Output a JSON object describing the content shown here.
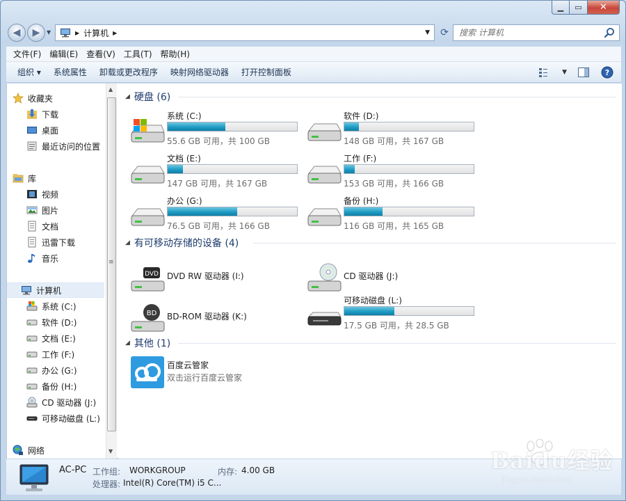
{
  "address": {
    "location": "计算机"
  },
  "search": {
    "placeholder": "搜索 计算机"
  },
  "menu": [
    {
      "label": "文件(F)"
    },
    {
      "label": "编辑(E)"
    },
    {
      "label": "查看(V)"
    },
    {
      "label": "工具(T)"
    },
    {
      "label": "帮助(H)"
    }
  ],
  "commands": [
    {
      "label": "组织 ▾"
    },
    {
      "label": "系统属性"
    },
    {
      "label": "卸载或更改程序"
    },
    {
      "label": "映射网络驱动器"
    },
    {
      "label": "打开控制面板"
    }
  ],
  "nav": {
    "favorites": {
      "label": "收藏夹",
      "items": [
        {
          "label": "下载"
        },
        {
          "label": "桌面"
        },
        {
          "label": "最近访问的位置"
        }
      ]
    },
    "libraries": {
      "label": "库",
      "items": [
        {
          "label": "视频"
        },
        {
          "label": "图片"
        },
        {
          "label": "文档"
        },
        {
          "label": "迅雷下载"
        },
        {
          "label": "音乐"
        }
      ]
    },
    "computer": {
      "label": "计算机",
      "items": [
        {
          "label": "系统 (C:)"
        },
        {
          "label": "软件 (D:)"
        },
        {
          "label": "文档 (E:)"
        },
        {
          "label": "工作 (F:)"
        },
        {
          "label": "办公 (G:)"
        },
        {
          "label": "备份 (H:)"
        },
        {
          "label": "CD 驱动器 (J:)"
        },
        {
          "label": "可移动磁盘 (L:)"
        }
      ]
    },
    "network": {
      "label": "网络"
    }
  },
  "groups": {
    "hard_disks": {
      "title": "硬盘 (6)"
    },
    "removable": {
      "title": "有可移动存储的设备 (4)"
    },
    "other": {
      "title": "其他 (1)"
    }
  },
  "drives": [
    {
      "name": "系统 (C:)",
      "free": "55.6 GB 可用，共 100 GB",
      "used_fraction": 0.444
    },
    {
      "name": "软件 (D:)",
      "free": "148 GB 可用，共 167 GB",
      "used_fraction": 0.114
    },
    {
      "name": "文档 (E:)",
      "free": "147 GB 可用，共 167 GB",
      "used_fraction": 0.12
    },
    {
      "name": "工作 (F:)",
      "free": "153 GB 可用，共 166 GB",
      "used_fraction": 0.078
    },
    {
      "name": "办公 (G:)",
      "free": "76.5 GB 可用，共 166 GB",
      "used_fraction": 0.539
    },
    {
      "name": "备份 (H:)",
      "free": "116 GB 可用，共 165 GB",
      "used_fraction": 0.297
    }
  ],
  "devices": [
    {
      "name": "DVD RW 驱动器 (I:)",
      "badge": "DVD"
    },
    {
      "name": "CD 驱动器 (J:)"
    },
    {
      "name": "BD-ROM 驱动器 (K:)",
      "badge": "BD"
    },
    {
      "name": "可移动磁盘 (L:)",
      "free": "17.5 GB 可用，共 28.5 GB",
      "used_fraction": 0.386
    }
  ],
  "other_items": [
    {
      "name": "百度云管家",
      "description": "双击运行百度云管家"
    }
  ],
  "details": {
    "pc_name": "AC-PC",
    "workgroup_label": "工作组:",
    "workgroup": "WORKGROUP",
    "memory_label": "内存:",
    "memory": "4.00 GB",
    "cpu_label": "处理器:",
    "cpu": "Intel(R) Core(TM) i5 C..."
  },
  "watermark": {
    "brand": "Baidu经验",
    "sub": "jingyan.baidu.com"
  },
  "colors": {
    "accent": "#1f9cc4",
    "selection": "#e5eef8",
    "group_title": "#1e3b6e"
  }
}
